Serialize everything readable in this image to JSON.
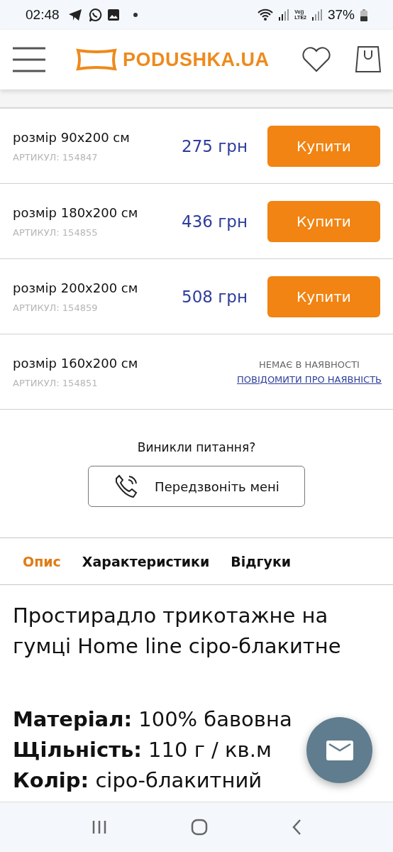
{
  "status_bar": {
    "time": "02:48",
    "network_top": "Vo))",
    "network_bottom": "LTE2",
    "battery": "37%"
  },
  "header": {
    "logo": "PODUSHKA.UA"
  },
  "variants": [
    {
      "kind": "buy",
      "size": "розмір 90x200 см",
      "sku": "АРТИКУЛ: 154847",
      "price": "275 грн",
      "button": "Купити"
    },
    {
      "kind": "buy",
      "size": "розмір 180x200 см",
      "sku": "АРТИКУЛ: 154855",
      "price": "436 грн",
      "button": "Купити"
    },
    {
      "kind": "buy",
      "size": "розмір 200x200 см",
      "sku": "АРТИКУЛ: 154859",
      "price": "508 грн",
      "button": "Купити"
    },
    {
      "kind": "unavailable",
      "size": "розмір 160x200 см",
      "sku": "АРТИКУЛ: 154851",
      "status": "НЕМАЄ В НАЯВНОСТІ",
      "link": "ПОВІДОМИТИ ПРО НАЯВНІСТЬ"
    }
  ],
  "callback": {
    "question": "Виникли питання?",
    "button": "Передзвоніть мені"
  },
  "tabs": [
    {
      "label": "Опис",
      "selected": true
    },
    {
      "label": "Характеристики",
      "selected": false
    },
    {
      "label": "Відгуки",
      "selected": false
    }
  ],
  "description": {
    "title": "Простирадло трикотажне на гумці Home line сіро-блакитне",
    "specs": [
      "**Матеріал:** 100% бавовна",
      "**Щільність:** 110 г / кв.м",
      "**Колір:** сіро-блакитний"
    ]
  }
}
